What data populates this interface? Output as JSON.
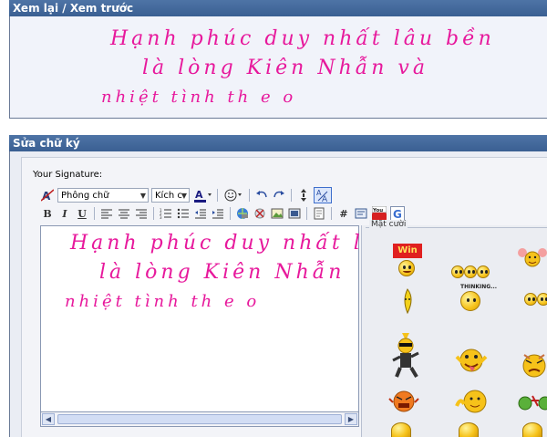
{
  "preview": {
    "title": "Xem lại / Xem trước",
    "lines": [
      "Hạnh phúc duy nhất lâu bền",
      "là lòng Kiên Nhẫn và",
      "nhiệt tình th e o"
    ]
  },
  "editor": {
    "title": "Sửa chữ ký",
    "signature_label": "Your Signature:",
    "font_dropdown": "Phông chữ",
    "size_dropdown": "Kích c",
    "lines": [
      "Hạnh phúc duy nhất lâ",
      "là lòng Kiên Nhẫn",
      "nhiệt tình th e o"
    ],
    "smilies_legend": "Mặt cười",
    "win_sign": "Win",
    "thinking_label": "THINKING...",
    "youtube_icon_text": "You"
  },
  "colors": {
    "header_bg": "#3f6699",
    "script_text": "#e7199c",
    "preview_bg": "#f1f3fa"
  }
}
